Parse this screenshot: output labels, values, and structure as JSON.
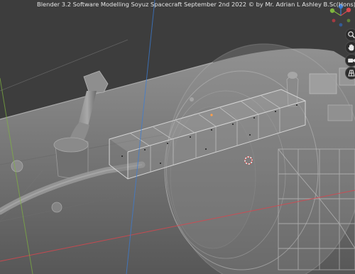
{
  "overlay": {
    "title": "Blender 3.2 Software Modelling Soyuz Spacecraft September 2nd 2022 © by Mr. Adrian L Ashley B.Sc(Hons) M.Sc M.Phil"
  },
  "navigation_gizmo": {
    "axes": [
      "x-axis",
      "y-axis",
      "z-axis"
    ],
    "tools": [
      "zoom-tool",
      "pan-tool",
      "camera-view-tool",
      "perspective-toggle"
    ]
  },
  "colors": {
    "background": "#3d3d3d",
    "hull": "#8a8a8a",
    "wireframe": "#b8b8b8",
    "x_axis": "#d8464e",
    "y_axis": "#7fb63e",
    "z_axis": "#3b7dd6",
    "selection_origin": "#ff9f4a"
  }
}
